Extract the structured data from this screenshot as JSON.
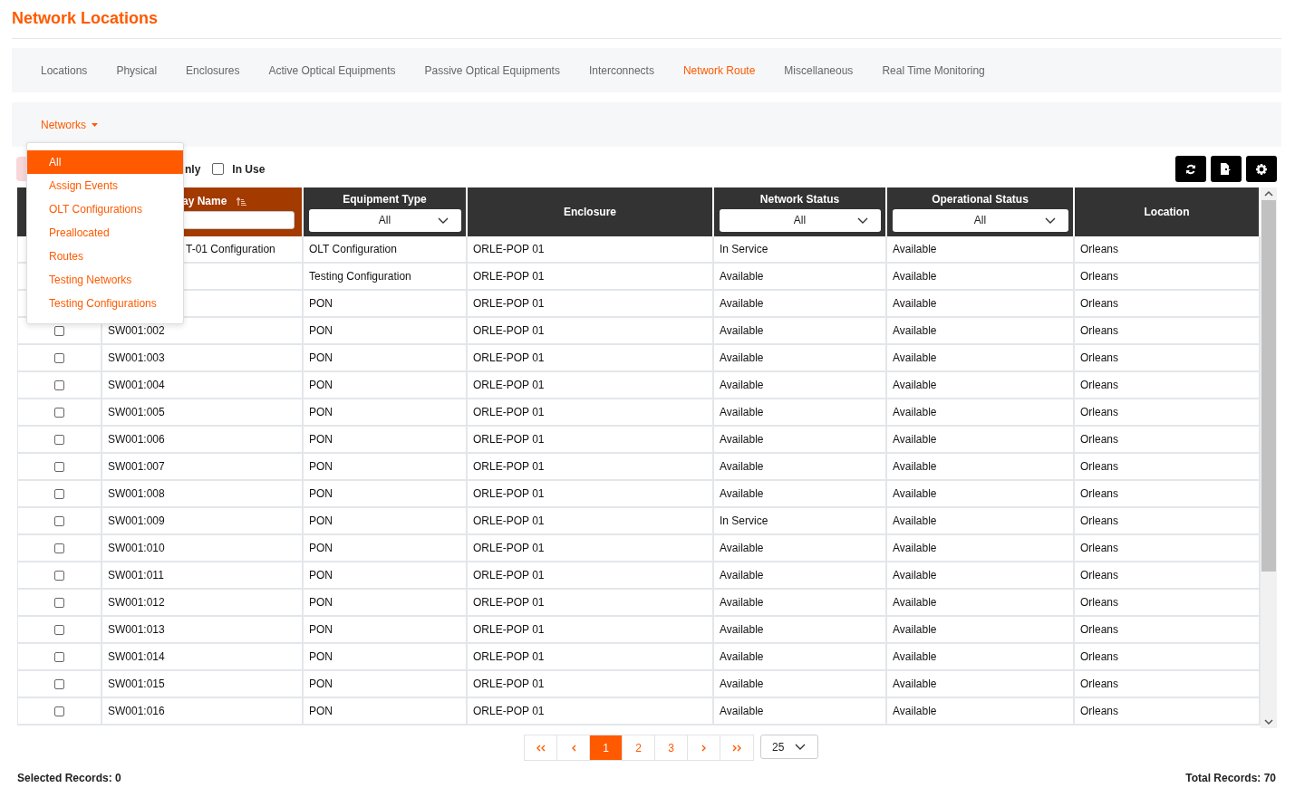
{
  "page_title": "Network Locations",
  "tabs": [
    {
      "label": "Locations",
      "selected": false
    },
    {
      "label": "Physical",
      "selected": false
    },
    {
      "label": "Enclosures",
      "selected": false
    },
    {
      "label": "Active Optical Equipments",
      "selected": false
    },
    {
      "label": "Passive Optical Equipments",
      "selected": false
    },
    {
      "label": "Interconnects",
      "selected": false
    },
    {
      "label": "Network Route",
      "selected": true
    },
    {
      "label": "Miscellaneous",
      "selected": false
    },
    {
      "label": "Real Time Monitoring",
      "selected": false
    }
  ],
  "menu": {
    "label": "Networks",
    "expanded": true,
    "items": [
      {
        "label": "All",
        "selected": true
      },
      {
        "label": "Assign Events",
        "selected": false
      },
      {
        "label": "OLT Configurations",
        "selected": false
      },
      {
        "label": "Preallocated",
        "selected": false
      },
      {
        "label": "Routes",
        "selected": false
      },
      {
        "label": "Testing Networks",
        "selected": false
      },
      {
        "label": "Testing Configurations",
        "selected": false
      }
    ]
  },
  "toolbar": {
    "clipped_label": "nly",
    "in_use": {
      "label": "In Use",
      "checked": false
    }
  },
  "columns": [
    {
      "kind": "text_filter",
      "title": "ay Name",
      "sorted": true
    },
    {
      "kind": "select_filter",
      "title": "Equipment Type",
      "sorted": false,
      "value": "All"
    },
    {
      "kind": "plain",
      "title": "Enclosure",
      "sorted": false
    },
    {
      "kind": "select_filter",
      "title": "Network Status",
      "sorted": false,
      "value": "All"
    },
    {
      "kind": "select_filter",
      "title": "Operational Status",
      "sorted": false,
      "value": "All"
    },
    {
      "kind": "plain",
      "title": "Location",
      "sorted": false
    }
  ],
  "rows": [
    {
      "name": "T-01 Configuration",
      "name_clipped": true,
      "cells": [
        "OLT Configuration",
        "ORLE-POP 01",
        "In Service",
        "Available",
        "Orleans"
      ]
    },
    {
      "cells": [
        "Testing Configuration",
        "ORLE-POP 01",
        "Available",
        "Available",
        "Orleans"
      ]
    },
    {
      "cells": [
        "PON",
        "ORLE-POP 01",
        "Available",
        "Available",
        "Orleans"
      ]
    },
    {
      "checked": false,
      "name": "SW001:002",
      "cells": [
        "PON",
        "ORLE-POP 01",
        "Available",
        "Available",
        "Orleans"
      ]
    },
    {
      "checked": false,
      "name": "SW001:003",
      "cells": [
        "PON",
        "ORLE-POP 01",
        "Available",
        "Available",
        "Orleans"
      ]
    },
    {
      "checked": false,
      "name": "SW001:004",
      "cells": [
        "PON",
        "ORLE-POP 01",
        "Available",
        "Available",
        "Orleans"
      ]
    },
    {
      "checked": false,
      "name": "SW001:005",
      "cells": [
        "PON",
        "ORLE-POP 01",
        "Available",
        "Available",
        "Orleans"
      ]
    },
    {
      "checked": false,
      "name": "SW001:006",
      "cells": [
        "PON",
        "ORLE-POP 01",
        "Available",
        "Available",
        "Orleans"
      ]
    },
    {
      "checked": false,
      "name": "SW001:007",
      "cells": [
        "PON",
        "ORLE-POP 01",
        "Available",
        "Available",
        "Orleans"
      ]
    },
    {
      "checked": false,
      "name": "SW001:008",
      "cells": [
        "PON",
        "ORLE-POP 01",
        "Available",
        "Available",
        "Orleans"
      ]
    },
    {
      "checked": false,
      "name": "SW001:009",
      "cells": [
        "PON",
        "ORLE-POP 01",
        "In Service",
        "Available",
        "Orleans"
      ]
    },
    {
      "checked": false,
      "name": "SW001:010",
      "cells": [
        "PON",
        "ORLE-POP 01",
        "Available",
        "Available",
        "Orleans"
      ]
    },
    {
      "checked": false,
      "name": "SW001:011",
      "cells": [
        "PON",
        "ORLE-POP 01",
        "Available",
        "Available",
        "Orleans"
      ]
    },
    {
      "checked": false,
      "name": "SW001:012",
      "cells": [
        "PON",
        "ORLE-POP 01",
        "Available",
        "Available",
        "Orleans"
      ]
    },
    {
      "checked": false,
      "name": "SW001:013",
      "cells": [
        "PON",
        "ORLE-POP 01",
        "Available",
        "Available",
        "Orleans"
      ]
    },
    {
      "checked": false,
      "name": "SW001:014",
      "cells": [
        "PON",
        "ORLE-POP 01",
        "Available",
        "Available",
        "Orleans"
      ]
    },
    {
      "checked": false,
      "name": "SW001:015",
      "cells": [
        "PON",
        "ORLE-POP 01",
        "Available",
        "Available",
        "Orleans"
      ]
    },
    {
      "checked": false,
      "name": "SW001:016",
      "cells": [
        "PON",
        "ORLE-POP 01",
        "Available",
        "Available",
        "Orleans"
      ]
    }
  ],
  "pagination": {
    "pages": [
      {
        "label": "1",
        "selected": true
      },
      {
        "label": "2",
        "selected": false
      },
      {
        "label": "3",
        "selected": false
      }
    ],
    "page_size": "25"
  },
  "selected_records": "Selected Records: 0",
  "total_records": "Total Records: 70"
}
